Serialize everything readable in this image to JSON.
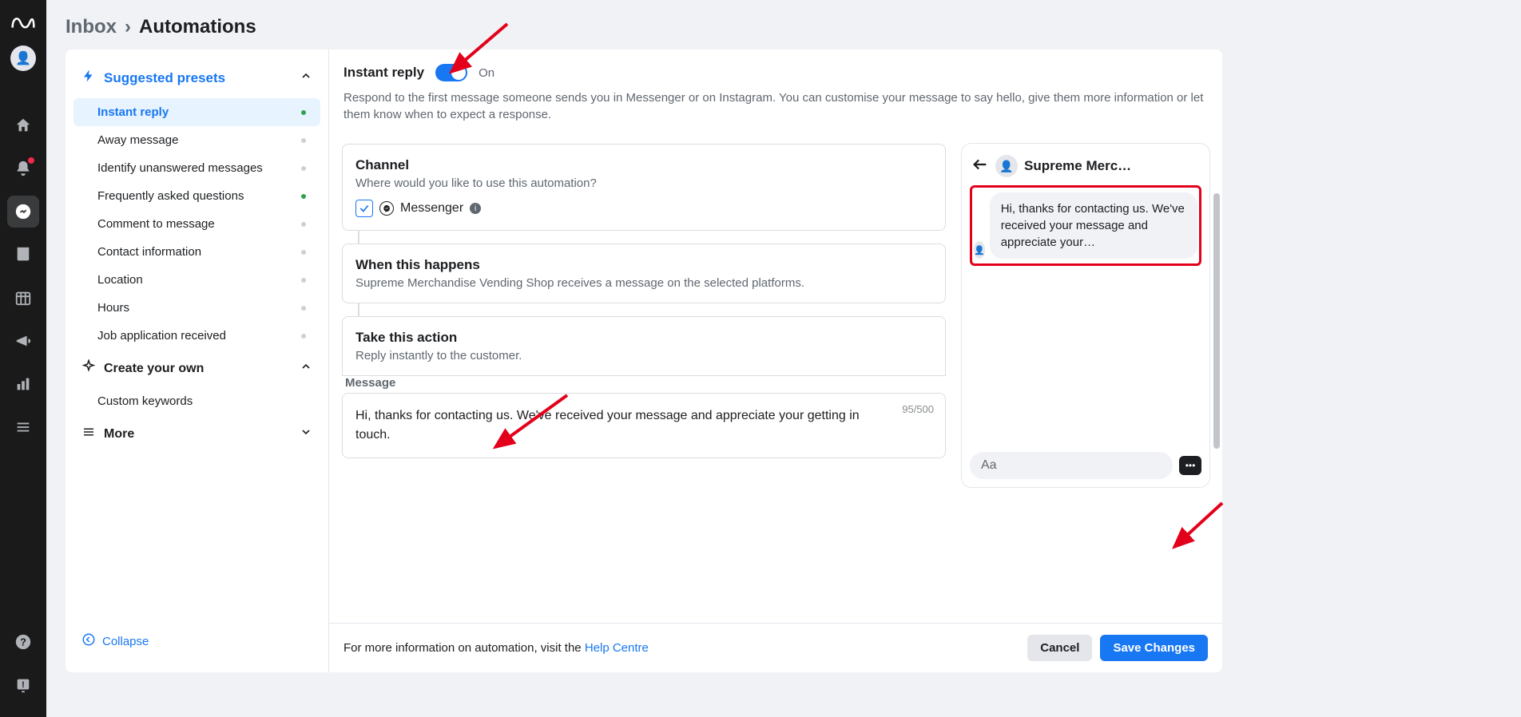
{
  "breadcrumb": {
    "parent": "Inbox",
    "current": "Automations"
  },
  "sidebar": {
    "suggested_header": "Suggested presets",
    "presets": [
      {
        "label": "Instant reply",
        "dot": "green",
        "active": true
      },
      {
        "label": "Away message",
        "dot": "gray"
      },
      {
        "label": "Identify unanswered messages",
        "dot": "gray"
      },
      {
        "label": "Frequently asked questions",
        "dot": "green"
      },
      {
        "label": "Comment to message",
        "dot": "gray"
      },
      {
        "label": "Contact information",
        "dot": "gray"
      },
      {
        "label": "Location",
        "dot": "gray"
      },
      {
        "label": "Hours",
        "dot": "gray"
      },
      {
        "label": "Job application received",
        "dot": "gray"
      }
    ],
    "create_own": "Create your own",
    "custom_keywords": "Custom keywords",
    "more": "More",
    "collapse": "Collapse"
  },
  "config": {
    "title": "Instant reply",
    "toggle_state": "On",
    "description": "Respond to the first message someone sends you in Messenger or on Instagram. You can customise your message to say hello, give them more information or let them know when to expect a response.",
    "channel": {
      "title": "Channel",
      "subtitle": "Where would you like to use this automation?",
      "option": "Messenger"
    },
    "when": {
      "title": "When this happens",
      "subtitle": "Supreme Merchandise Vending Shop receives a message on the selected platforms."
    },
    "action": {
      "title": "Take this action",
      "subtitle": "Reply instantly to the customer."
    },
    "message": {
      "label": "Message",
      "text": "Hi, thanks for contacting us. We've received your message and appreciate your getting in touch.",
      "counter": "95/500"
    },
    "preview": {
      "page_name": "Supreme Merc…",
      "bubble_text": "Hi, thanks for contacting us. We've received your message and appreciate your…",
      "input_placeholder": "Aa"
    },
    "footer": {
      "text": "For more information on automation, visit the ",
      "link": "Help Centre",
      "cancel": "Cancel",
      "save": "Save Changes"
    }
  }
}
